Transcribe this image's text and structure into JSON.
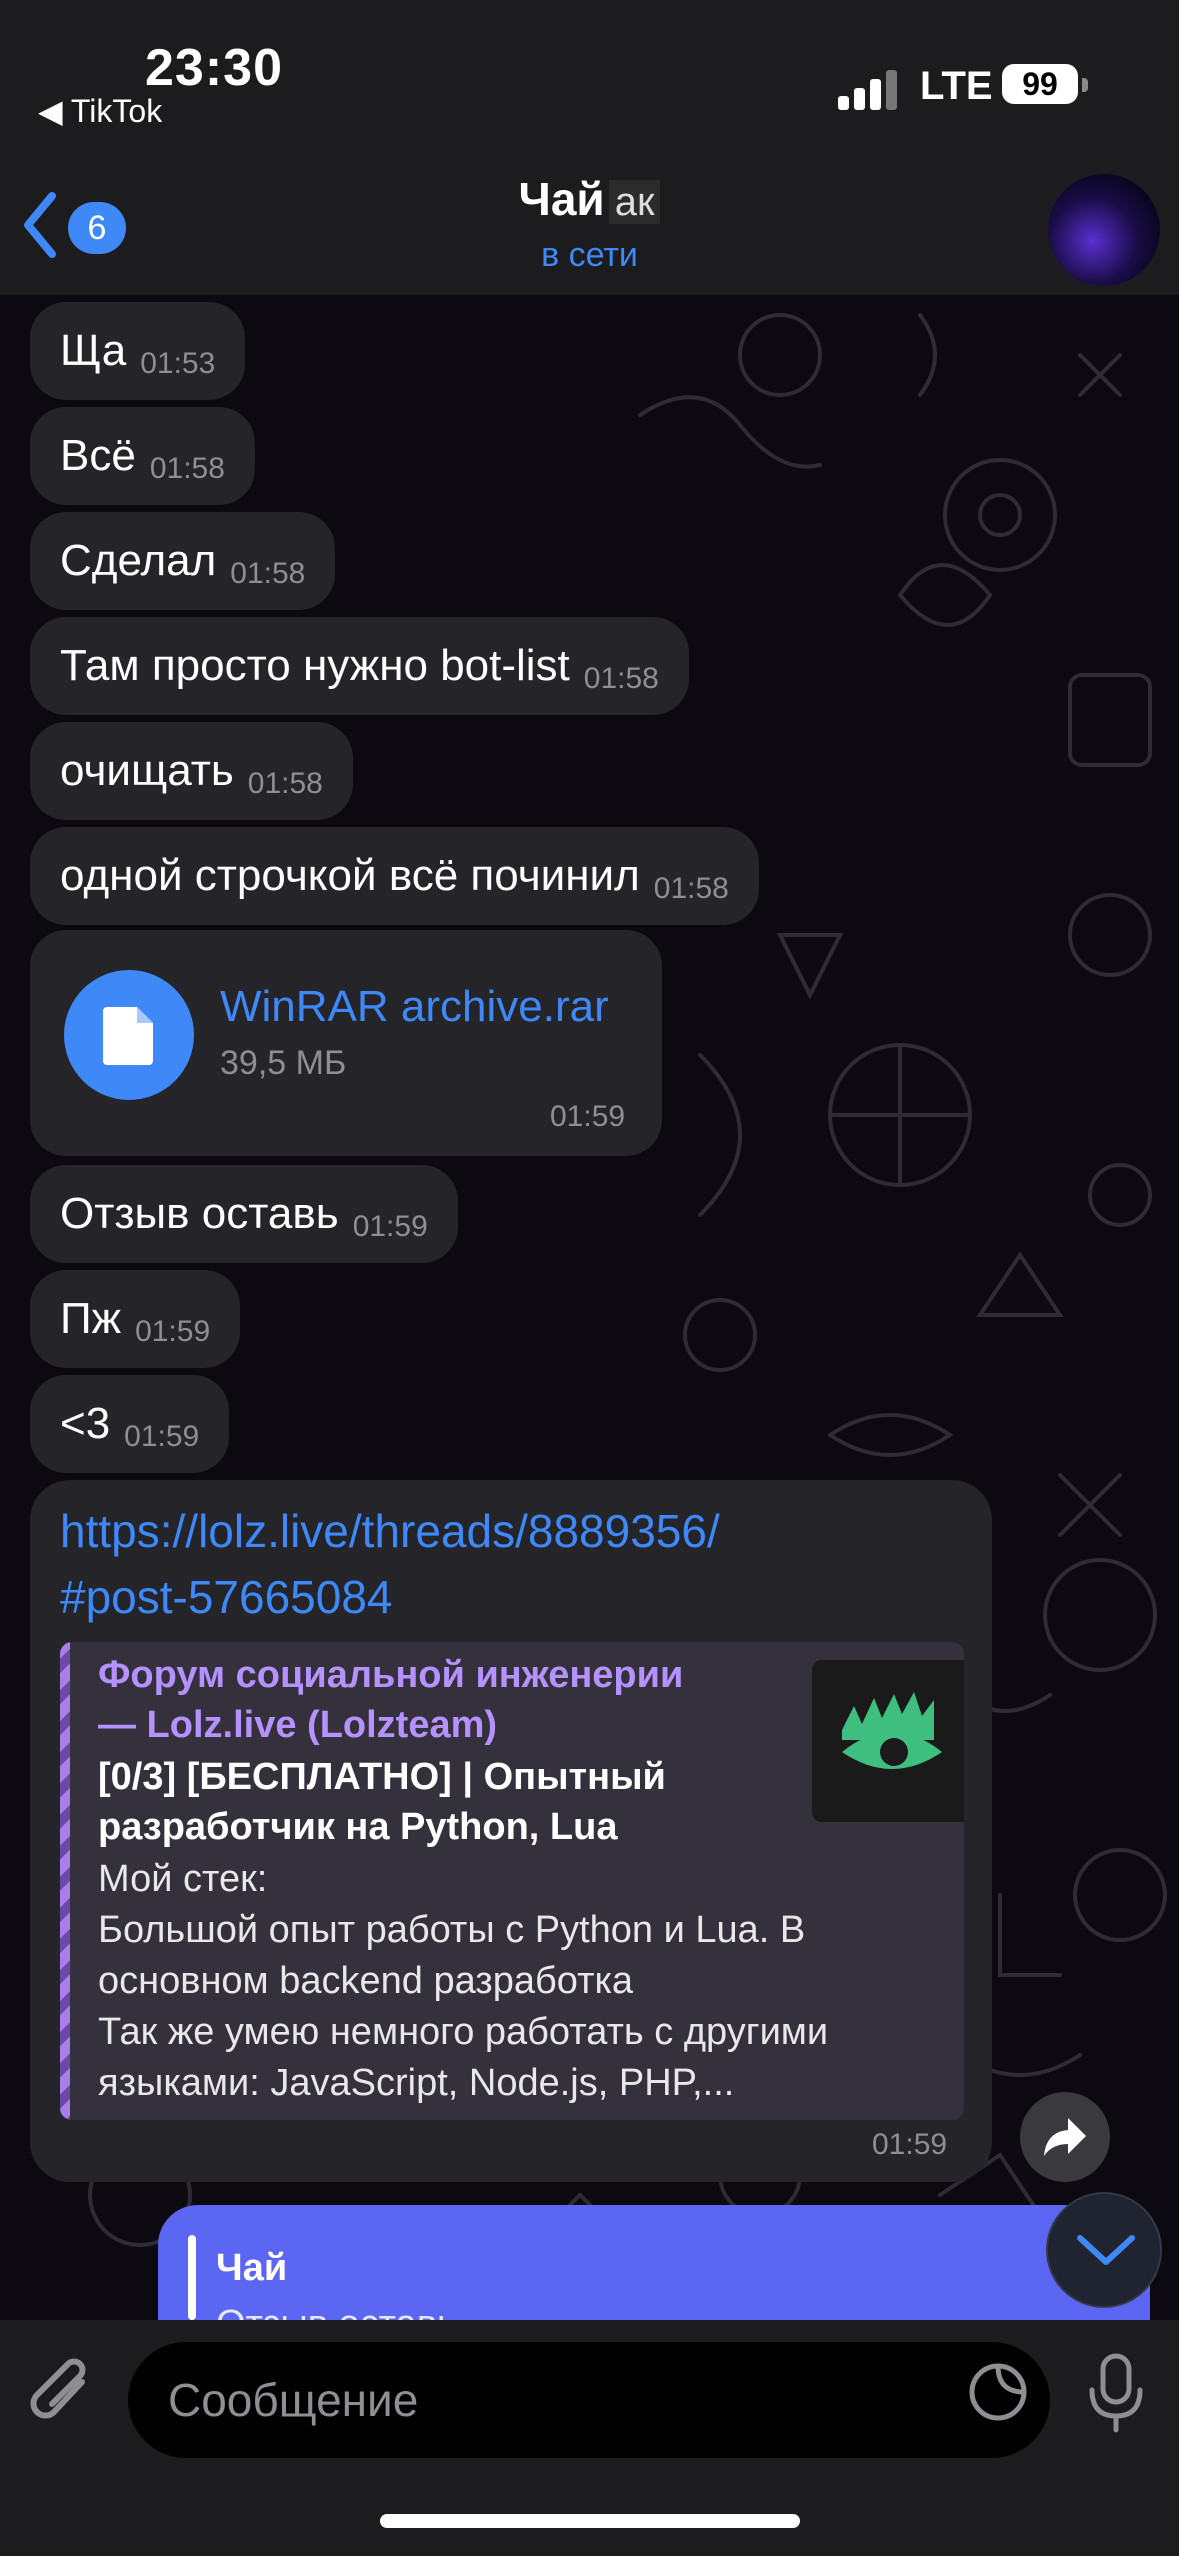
{
  "status_bar": {
    "time": "23:30",
    "back_app": "◀ TikTok",
    "network": "LTE",
    "battery": "99"
  },
  "header": {
    "unread_count": "6",
    "title": "Чай",
    "title_tag": "ак",
    "status": "в сети"
  },
  "messages": [
    {
      "text": "Ща",
      "time": "01:53"
    },
    {
      "text": "Всё",
      "time": "01:58"
    },
    {
      "text": "Сделал",
      "time": "01:58"
    },
    {
      "text": "Там просто нужно bot-list",
      "time": "01:58"
    },
    {
      "text": "очищать",
      "time": "01:58"
    },
    {
      "text": "одной строчкой всё починил",
      "time": "01:58"
    },
    {
      "text": "Отзыв оставь",
      "time": "01:59"
    },
    {
      "text": "Пж",
      "time": "01:59"
    },
    {
      "text": "<3",
      "time": "01:59"
    }
  ],
  "file_message": {
    "name": "WinRAR archive.rar",
    "size": "39,5 МБ",
    "time": "01:59"
  },
  "link_message": {
    "url_line1": "https://lolz.live/threads/8889356/",
    "url_line2": "#post-57665084",
    "preview_site_line1": "Форум социальной инженерии",
    "preview_site_line2": "— Lolz.live (Lolzteam)",
    "preview_title_line1": "[0/3] [БЕСПЛАТНО] | Опытный",
    "preview_title_line2": "разработчик на Python, Lua",
    "preview_desc": [
      "Мой стек:",
      "Большой опыт работы с Python и Lua. В",
      "основном backend разработка",
      "Так же умею немного работать с другими",
      "языками: JavaScript, Node.js, PHP,..."
    ],
    "time": "01:59"
  },
  "outgoing_reply": {
    "name": "Чай",
    "quote": "Отзыв оставь"
  },
  "input": {
    "placeholder": "Сообщение"
  },
  "colors": {
    "accent": "#3e88f7",
    "bubble": "#252428",
    "outgoing": "#5b66f2",
    "preview_accent": "#b592ff"
  }
}
